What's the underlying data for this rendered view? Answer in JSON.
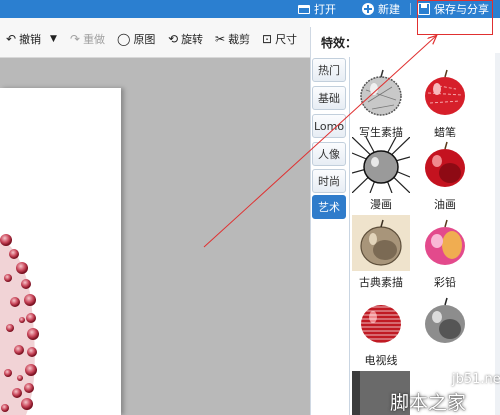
{
  "topbar": {
    "open_label": "打开",
    "new_label": "新建",
    "save_share_label": "保存与分享",
    "color": "#2b7fd0"
  },
  "toolbar": {
    "undo_label": "撤销",
    "redo_label": "重做",
    "original_label": "原图",
    "rotate_label": "旋转",
    "crop_label": "裁剪",
    "size_label": "尺寸"
  },
  "panel": {
    "title": "特效：",
    "tabs": [
      {
        "label": "热门",
        "active": false
      },
      {
        "label": "基础",
        "active": false
      },
      {
        "label": "Lomo",
        "active": false
      },
      {
        "label": "人像",
        "active": false
      },
      {
        "label": "时尚",
        "active": false
      },
      {
        "label": "艺术",
        "active": true
      }
    ],
    "effects": [
      {
        "label": "写生素描",
        "style": "sketch"
      },
      {
        "label": "蜡笔",
        "style": "crayon"
      },
      {
        "label": "漫画",
        "style": "comic"
      },
      {
        "label": "油画",
        "style": "oil"
      },
      {
        "label": "古典素描",
        "style": "classic-sketch"
      },
      {
        "label": "彩铅",
        "style": "color-pencil"
      },
      {
        "label": "电视线",
        "style": "tv-lines"
      },
      {
        "label": "",
        "style": "gray-apple"
      }
    ],
    "active_tab_color": "#2f7ccb"
  },
  "annotation": {
    "highlight_color": "#e03030"
  },
  "watermark": {
    "site": "jb51.net",
    "name": "脚本之家"
  }
}
